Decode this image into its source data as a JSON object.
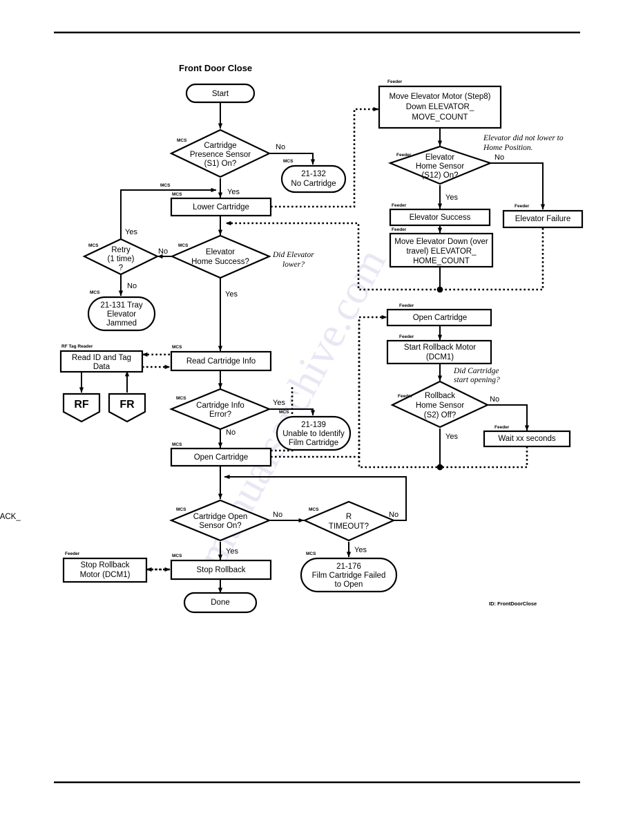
{
  "page": {
    "title": "Front Door Close",
    "id_label": "ID: FrontDoorClose",
    "watermark": "manualsarchive.com"
  },
  "lanes": {
    "mcs": "MCS",
    "feeder": "Feeder",
    "rf_tag_reader": "RF Tag Reader"
  },
  "edge_labels": {
    "yes": "Yes",
    "no": "No"
  },
  "annotations": [
    {
      "id": "ann_did_elevator_lower",
      "line1": "Did Elevator",
      "line2": "lower?"
    },
    {
      "id": "ann_elevator_not_home",
      "line1": "Elevator did not lower to",
      "line2": "Home Position."
    },
    {
      "id": "ann_did_cartridge_open",
      "line1": "Did Cartridge",
      "line2": "start opening?"
    }
  ],
  "nodes": [
    {
      "id": "start",
      "shape": "terminator",
      "lane": "",
      "lines": [
        "Start"
      ]
    },
    {
      "id": "cart_presence",
      "shape": "decision",
      "lane": "MCS",
      "lines": [
        "Cartridge",
        "Presence Sensor",
        "(S1) On?"
      ]
    },
    {
      "id": "err_21_132",
      "shape": "terminator",
      "lane": "MCS",
      "lines": [
        "21-132",
        "No Cartridge"
      ]
    },
    {
      "id": "lower_cartridge",
      "shape": "process",
      "lane": "MCS",
      "lines": [
        "Lower Cartridge"
      ]
    },
    {
      "id": "elevator_home_succ",
      "shape": "decision",
      "lane": "MCS",
      "lines": [
        "Elevator",
        "Home Success?"
      ]
    },
    {
      "id": "retry",
      "shape": "decision",
      "lane": "MCS",
      "lines": [
        "Retry",
        "(1 time)",
        "?"
      ]
    },
    {
      "id": "err_21_131",
      "shape": "terminator",
      "lane": "MCS",
      "lines": [
        "21-131 Tray",
        "Elevator",
        "Jammed"
      ]
    },
    {
      "id": "read_cart_info",
      "shape": "process",
      "lane": "MCS",
      "lines": [
        "Read Cartridge Info"
      ]
    },
    {
      "id": "read_id_tag",
      "shape": "process",
      "lane": "RF Tag Reader",
      "lines": [
        "Read ID and Tag",
        "Data"
      ]
    },
    {
      "id": "conn_rf",
      "shape": "offpage",
      "lane": "",
      "lines": [
        "RF"
      ]
    },
    {
      "id": "conn_fr",
      "shape": "offpage",
      "lane": "",
      "lines": [
        "FR"
      ]
    },
    {
      "id": "cart_info_error",
      "shape": "decision",
      "lane": "MCS",
      "lines": [
        "Cartridge Info",
        "Error?"
      ]
    },
    {
      "id": "err_21_139",
      "shape": "terminator",
      "lane": "MCS",
      "lines": [
        "21-139",
        "Unable to Identify",
        "Film Cartridge"
      ]
    },
    {
      "id": "open_cartridge_mcs",
      "shape": "process",
      "lane": "MCS",
      "lines": [
        "Open Cartridge"
      ]
    },
    {
      "id": "cart_open_sensor",
      "shape": "decision",
      "lane": "MCS",
      "lines": [
        "Cartridge Open",
        "Sensor On?"
      ]
    },
    {
      "id": "rollback_timeout",
      "shape": "decision",
      "lane": "MCS",
      "lines": [
        "ROLLBACK_",
        "TIMEOUT?"
      ]
    },
    {
      "id": "err_21_176",
      "shape": "terminator",
      "lane": "MCS",
      "lines": [
        "21-176",
        "Film Cartridge Failed",
        "to Open"
      ]
    },
    {
      "id": "stop_rollback_mcs",
      "shape": "process",
      "lane": "MCS",
      "lines": [
        "Stop Rollback"
      ]
    },
    {
      "id": "stop_rollback_motor",
      "shape": "process",
      "lane": "Feeder",
      "lines": [
        "Stop Rollback",
        "Motor (DCM1)"
      ]
    },
    {
      "id": "done",
      "shape": "terminator",
      "lane": "",
      "lines": [
        "Done"
      ]
    },
    {
      "id": "move_elev_motor",
      "shape": "process",
      "lane": "Feeder",
      "lines": [
        "Move Elevator Motor (Step8)",
        "Down ELEVATOR_",
        "MOVE_COUNT"
      ]
    },
    {
      "id": "elev_home_sensor",
      "shape": "decision",
      "lane": "Feeder",
      "lines": [
        "Elevator",
        "Home Sensor",
        "(S12) On?"
      ]
    },
    {
      "id": "elev_success",
      "shape": "process",
      "lane": "Feeder",
      "lines": [
        "Elevator Success"
      ]
    },
    {
      "id": "elev_failure",
      "shape": "process",
      "lane": "Feeder",
      "lines": [
        "Elevator Failure"
      ]
    },
    {
      "id": "move_elev_down",
      "shape": "process",
      "lane": "Feeder",
      "lines": [
        "Move Elevator Down (over",
        "travel) ELEVATOR_",
        "HOME_COUNT"
      ]
    },
    {
      "id": "open_cartridge_fdr",
      "shape": "process",
      "lane": "Feeder",
      "lines": [
        "Open Cartridge"
      ]
    },
    {
      "id": "start_rollback_mtr",
      "shape": "process",
      "lane": "Feeder",
      "lines": [
        "Start Rollback Motor",
        "(DCM1)"
      ]
    },
    {
      "id": "rollback_home_sens",
      "shape": "decision",
      "lane": "Feeder",
      "lines": [
        "Rollback",
        "Home Sensor",
        "(S2) Off?"
      ]
    },
    {
      "id": "wait_xx",
      "shape": "process",
      "lane": "Feeder",
      "lines": [
        "Wait xx seconds"
      ]
    }
  ]
}
